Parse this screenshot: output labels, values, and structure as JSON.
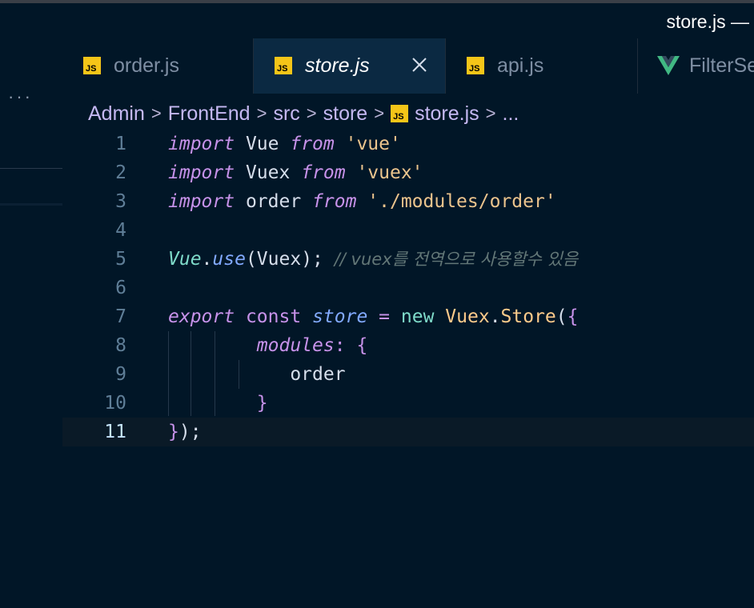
{
  "window": {
    "title": "store.js —"
  },
  "sidebar": {
    "more_label": "···"
  },
  "tabs": [
    {
      "label": "order.js",
      "icon": "js-icon",
      "active": false
    },
    {
      "label": "store.js",
      "icon": "js-icon",
      "active": true
    },
    {
      "label": "api.js",
      "icon": "js-icon",
      "active": false
    },
    {
      "label": "FilterSe",
      "icon": "vue-icon",
      "active": false
    }
  ],
  "breadcrumb": {
    "items": [
      "Admin",
      "FrontEnd",
      "src",
      "store",
      "store.js",
      "..."
    ],
    "separator": ">"
  },
  "js_badge_text": "JS",
  "editor": {
    "lines": [
      {
        "num": "1",
        "tokens": [
          [
            "kw-i",
            "import"
          ],
          [
            "plain",
            " Vue "
          ],
          [
            "kw-i",
            "from"
          ],
          [
            "plain",
            " "
          ],
          [
            "str",
            "'vue'"
          ]
        ]
      },
      {
        "num": "2",
        "tokens": [
          [
            "kw-i",
            "import"
          ],
          [
            "plain",
            " Vuex "
          ],
          [
            "kw-i",
            "from"
          ],
          [
            "plain",
            " "
          ],
          [
            "str",
            "'vuex'"
          ]
        ]
      },
      {
        "num": "3",
        "tokens": [
          [
            "kw-i",
            "import"
          ],
          [
            "plain",
            " order "
          ],
          [
            "kw-i",
            "from"
          ],
          [
            "plain",
            " "
          ],
          [
            "str",
            "'./modules/order'"
          ]
        ]
      },
      {
        "num": "4",
        "tokens": []
      },
      {
        "num": "5",
        "tokens": [
          [
            "cls",
            "Vue"
          ],
          [
            "plain",
            "."
          ],
          [
            "fn",
            "use"
          ],
          [
            "plain",
            "(Vuex); "
          ],
          [
            "comment",
            "// vuex를 전역으로 사용할수 있음"
          ]
        ]
      },
      {
        "num": "6",
        "tokens": []
      },
      {
        "num": "7",
        "tokens": [
          [
            "kw-i",
            "export"
          ],
          [
            "plain",
            " "
          ],
          [
            "kw",
            "const"
          ],
          [
            "plain",
            " "
          ],
          [
            "fn",
            "store"
          ],
          [
            "plain",
            " "
          ],
          [
            "op",
            "="
          ],
          [
            "plain",
            " "
          ],
          [
            "new",
            "new"
          ],
          [
            "plain",
            " "
          ],
          [
            "ty",
            "Vuex"
          ],
          [
            "plain",
            "."
          ],
          [
            "ty",
            "Store"
          ],
          [
            "plain",
            "("
          ],
          [
            "br",
            "{"
          ]
        ]
      },
      {
        "num": "8",
        "tokens": [
          [
            "plain",
            "        "
          ],
          [
            "prop",
            "modules"
          ],
          [
            "op",
            ":"
          ],
          [
            "plain",
            " "
          ],
          [
            "br",
            "{"
          ]
        ]
      },
      {
        "num": "9",
        "tokens": [
          [
            "plain",
            "           order"
          ]
        ]
      },
      {
        "num": "10",
        "tokens": [
          [
            "plain",
            "        "
          ],
          [
            "br",
            "}"
          ]
        ]
      },
      {
        "num": "11",
        "tokens": [
          [
            "br",
            "}"
          ],
          [
            "plain",
            ");"
          ]
        ]
      }
    ],
    "current_line": 11
  },
  "colors": {
    "background": "#011627",
    "keyword": "#c792ea",
    "string": "#ecc48d",
    "function": "#82aaff",
    "comment": "#637777",
    "line_number": "#5f7e97"
  }
}
